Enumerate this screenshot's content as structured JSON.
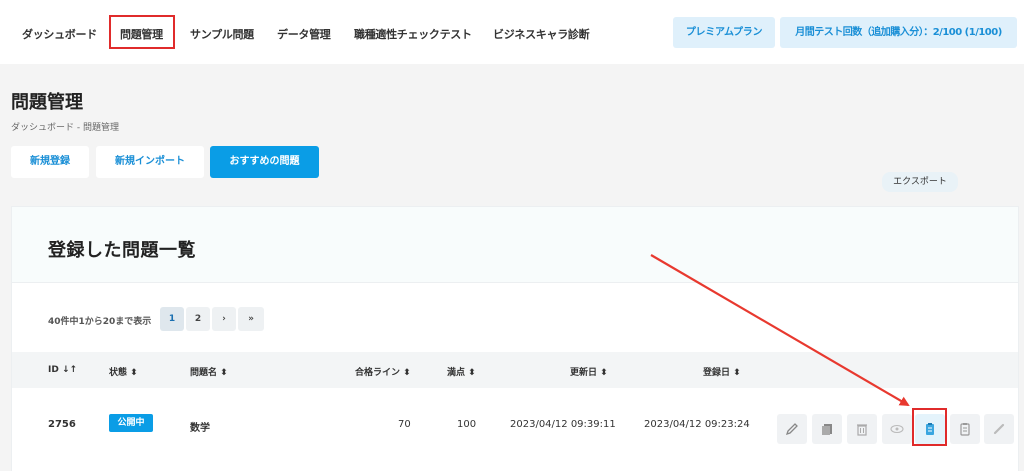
{
  "nav": {
    "items": [
      "ダッシュボード",
      "問題管理",
      "サンプル問題",
      "データ管理",
      "職種適性チェックテスト",
      "ビジネスキャラ診断"
    ],
    "plan_button": "プレミアムプラン",
    "quota_button": "月間テスト回数（追加購入分）：2/100 (1/100)"
  },
  "header": {
    "title": "問題管理",
    "breadcrumb": "ダッシュボード - 問題管理",
    "buttons": [
      "新規登録",
      "新規インポート",
      "おすすめの問題"
    ]
  },
  "list": {
    "title": "登録した問題一覧",
    "pager_info": "40件中1から20まで表示",
    "pages": [
      "1",
      "2",
      "›",
      "»"
    ],
    "columns": [
      "ID",
      "状態",
      "問題名",
      "合格ライン",
      "満点",
      "更新日",
      "登録日"
    ],
    "rows": [
      {
        "id": "2756",
        "status": "公開中",
        "name": "数学",
        "pass_line": "70",
        "full_score": "100",
        "updated": "2023/04/12 09:39:11",
        "created": "2023/04/12 09:23:24"
      }
    ],
    "tooltip": "エクスポート",
    "actions": [
      "edit-icon",
      "copy-icon",
      "trash-icon",
      "eye-icon",
      "export-icon",
      "clipboard-icon",
      "link-icon"
    ]
  },
  "colors": {
    "accent": "#0a9de6",
    "highlight": "#e02b2b"
  }
}
